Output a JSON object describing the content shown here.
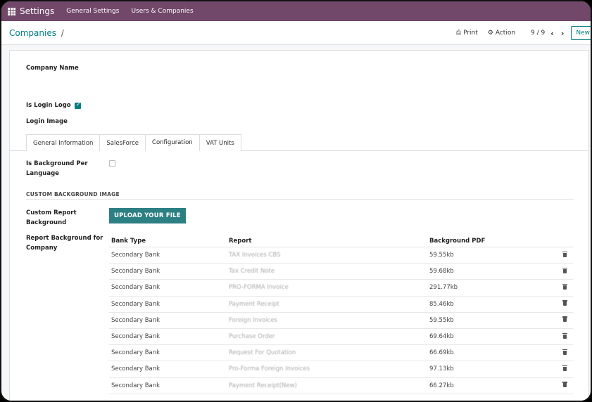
{
  "topbar": {
    "app_title": "Settings",
    "menu": [
      "General Settings",
      "Users & Companies"
    ]
  },
  "control": {
    "breadcrumb": "Companies",
    "breadcrumb_sep": "/",
    "print_label": "Print",
    "action_label": "Action",
    "pager": "9 / 9",
    "new_label": "New"
  },
  "form": {
    "company_name_label": "Company Name",
    "is_login_logo_label": "Is Login Logo",
    "is_login_logo_checked": true,
    "login_image_label": "Login Image",
    "tabs": [
      {
        "label": "General Information",
        "active": false
      },
      {
        "label": "SalesForce",
        "active": false
      },
      {
        "label": "Configuration",
        "active": true
      },
      {
        "label": "VAT Units",
        "active": false
      }
    ],
    "is_background_per_language_label": "Is Background Per Language",
    "is_background_per_language_checked": false,
    "section_title": "CUSTOM BACKGROUND IMAGE",
    "custom_report_background_label": "Custom Report Background",
    "upload_label": "UPLOAD YOUR FILE",
    "report_background_label": "Report Background for Company"
  },
  "table": {
    "headers": [
      "Bank Type",
      "Report",
      "Background PDF"
    ],
    "rows": [
      {
        "bank_type": "Secondary Bank",
        "report": "TAX Invoices CBS",
        "pdf": "59.55kb"
      },
      {
        "bank_type": "Secondary Bank",
        "report": "Tax Credit Note",
        "pdf": "59.68kb"
      },
      {
        "bank_type": "Secondary Bank",
        "report": "PRO-FORMA Invoice",
        "pdf": "291.77kb"
      },
      {
        "bank_type": "Secondary Bank",
        "report": "Payment Receipt",
        "pdf": "85.46kb"
      },
      {
        "bank_type": "Secondary Bank",
        "report": "Foreign Invoices",
        "pdf": "59.55kb"
      },
      {
        "bank_type": "Secondary Bank",
        "report": "Purchase Order",
        "pdf": "69.64kb"
      },
      {
        "bank_type": "Secondary Bank",
        "report": "Request For Quotation",
        "pdf": "66.69kb"
      },
      {
        "bank_type": "Secondary Bank",
        "report": "Pro-Forma Foreign Invoices",
        "pdf": "97.13kb"
      },
      {
        "bank_type": "Secondary Bank",
        "report": "Payment Receipt(New)",
        "pdf": "66.27kb"
      }
    ]
  },
  "colors": {
    "topbar": "#71476a",
    "accent": "#017e84",
    "upload_button": "#2c7f82"
  },
  "icons": {
    "apps": "apps-grid-icon",
    "print": "print-icon",
    "action": "gear-icon",
    "prev": "chevron-left-icon",
    "next": "chevron-right-icon",
    "delete": "trash-icon"
  }
}
